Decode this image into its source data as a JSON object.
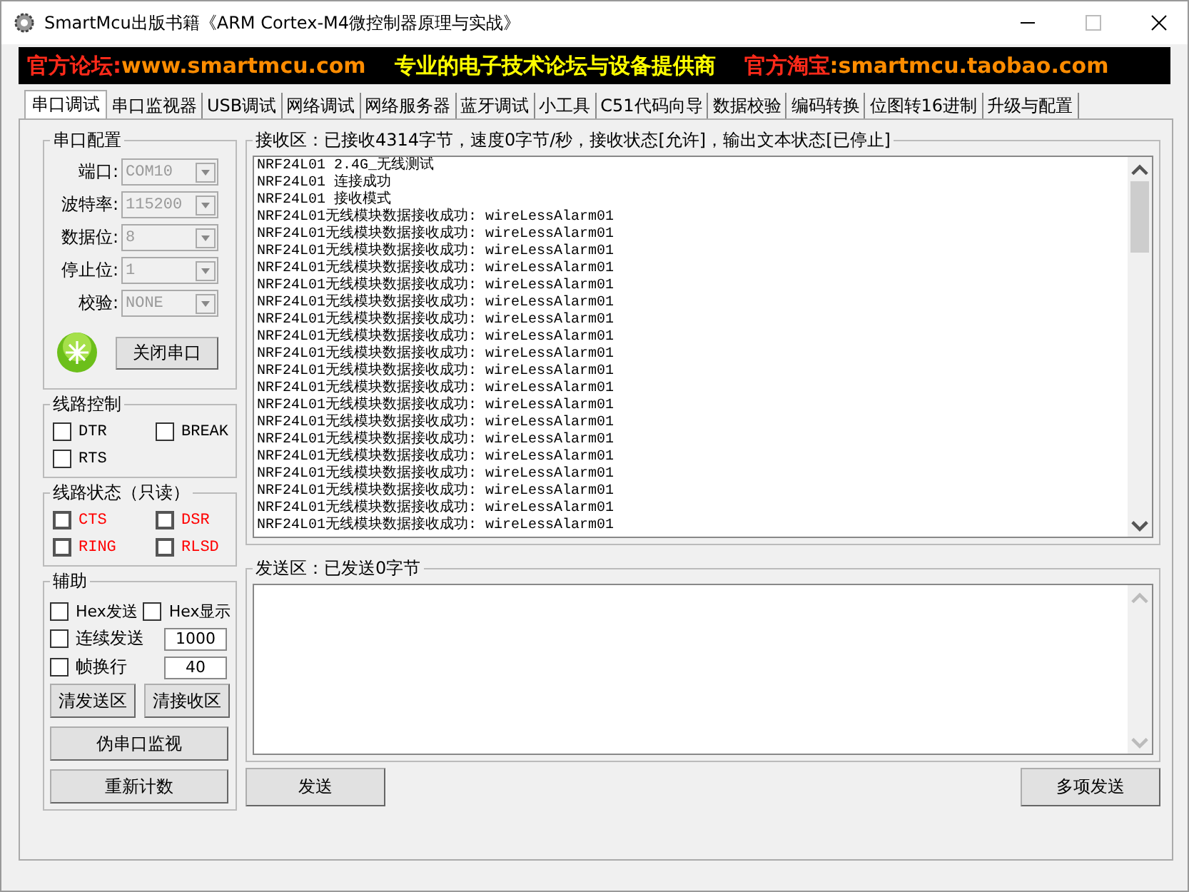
{
  "window": {
    "title": "SmartMcu出版书籍《ARM Cortex-M4微控制器原理与实战》"
  },
  "banner": [
    {
      "text": "官方论坛:",
      "color": "#ff2a1a"
    },
    {
      "text": "www.smartmcu.com",
      "color": "#ff8c00"
    },
    {
      "text": "专业的电子技术论坛与设备提供商",
      "color": "#ffff00"
    },
    {
      "text": "官方淘宝",
      "color": "#ff2a1a"
    },
    {
      "text": ":smartmcu.taobao.com",
      "color": "#ff8c00"
    }
  ],
  "tabs": [
    {
      "label": "串口调试",
      "selected": true
    },
    {
      "label": "串口监视器",
      "selected": false
    },
    {
      "label": "USB调试",
      "selected": false
    },
    {
      "label": "网络调试",
      "selected": false
    },
    {
      "label": "网络服务器",
      "selected": false
    },
    {
      "label": "蓝牙调试",
      "selected": false
    },
    {
      "label": "小工具",
      "selected": false
    },
    {
      "label": "C51代码向导",
      "selected": false
    },
    {
      "label": "数据校验",
      "selected": false
    },
    {
      "label": "编码转换",
      "selected": false
    },
    {
      "label": "位图转16进制",
      "selected": false
    },
    {
      "label": "升级与配置",
      "selected": false
    }
  ],
  "serial_config": {
    "title": "串口配置",
    "fields": [
      {
        "label": "端口:",
        "value": "COM10",
        "disabled": true
      },
      {
        "label": "波特率:",
        "value": "115200",
        "disabled": true
      },
      {
        "label": "数据位:",
        "value": "8",
        "disabled": true
      },
      {
        "label": "停止位:",
        "value": "1",
        "disabled": true
      },
      {
        "label": "校验:",
        "value": "NONE",
        "disabled": true
      }
    ],
    "port_open": true,
    "toggle_button": "关闭串口"
  },
  "line_control": {
    "title": "线路控制",
    "items": [
      {
        "label": "DTR",
        "checked": false
      },
      {
        "label": "BREAK",
        "checked": false
      },
      {
        "label": "RTS",
        "checked": false
      }
    ]
  },
  "line_status": {
    "title": "线路状态（只读）",
    "items": [
      {
        "label": "CTS",
        "checked": false
      },
      {
        "label": "DSR",
        "checked": false
      },
      {
        "label": "RING",
        "checked": false
      },
      {
        "label": "RLSD",
        "checked": false
      }
    ]
  },
  "assist": {
    "title": "辅助",
    "hex_send": {
      "label": "Hex发送",
      "checked": false
    },
    "hex_display": {
      "label": "Hex显示",
      "checked": false
    },
    "continuous_send": {
      "label": "连续发送",
      "checked": false,
      "value": "1000"
    },
    "frame_newline": {
      "label": "帧换行",
      "checked": false,
      "value": "40"
    },
    "buttons": [
      "清发送区",
      "清接收区"
    ],
    "wide_buttons": [
      "伪串口监视",
      "重新计数"
    ]
  },
  "receive": {
    "title": "接收区：已接收4314字节，速度0字节/秒，接收状态[允许]，输出文本状态[已停止]",
    "lines": [
      "NRF24L01 2.4G_无线测试",
      "NRF24L01 连接成功",
      "NRF24L01 接收模式",
      "NRF24L01无线模块数据接收成功: wireLessAlarm01",
      "NRF24L01无线模块数据接收成功: wireLessAlarm01",
      "NRF24L01无线模块数据接收成功: wireLessAlarm01",
      "NRF24L01无线模块数据接收成功: wireLessAlarm01",
      "NRF24L01无线模块数据接收成功: wireLessAlarm01",
      "NRF24L01无线模块数据接收成功: wireLessAlarm01",
      "NRF24L01无线模块数据接收成功: wireLessAlarm01",
      "NRF24L01无线模块数据接收成功: wireLessAlarm01",
      "NRF24L01无线模块数据接收成功: wireLessAlarm01",
      "NRF24L01无线模块数据接收成功: wireLessAlarm01",
      "NRF24L01无线模块数据接收成功: wireLessAlarm01",
      "NRF24L01无线模块数据接收成功: wireLessAlarm01",
      "NRF24L01无线模块数据接收成功: wireLessAlarm01",
      "NRF24L01无线模块数据接收成功: wireLessAlarm01",
      "NRF24L01无线模块数据接收成功: wireLessAlarm01",
      "NRF24L01无线模块数据接收成功: wireLessAlarm01",
      "NRF24L01无线模块数据接收成功: wireLessAlarm01",
      "NRF24L01无线模块数据接收成功: wireLessAlarm01",
      "NRF24L01无线模块数据接收成功: wireLessAlarm01"
    ]
  },
  "send": {
    "title": "发送区：已发送0字节",
    "send_button": "发送",
    "multi_send_button": "多项发送"
  }
}
